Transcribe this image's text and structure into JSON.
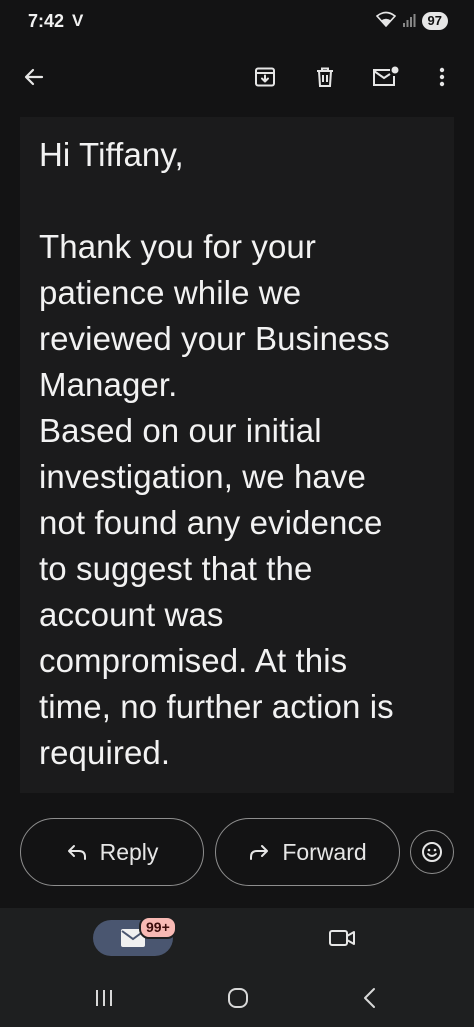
{
  "status_bar": {
    "time": "7:42",
    "carrier_icon": "V",
    "battery": "97"
  },
  "app_bar": {
    "icons": [
      "back-arrow-icon",
      "archive-icon",
      "delete-icon",
      "mark-unread-icon",
      "more-vert-icon"
    ]
  },
  "email": {
    "greeting": "Hi Tiffany,",
    "body_lines": [
      "Thank you for your",
      "patience while we",
      "reviewed your Business",
      "Manager.",
      "Based on our initial",
      "investigation, we have",
      "not found any evidence",
      "to suggest that the",
      "account was",
      "compromised. At this",
      "time, no further action is",
      "required."
    ]
  },
  "actions": {
    "reply_label": "Reply",
    "forward_label": "Forward"
  },
  "bottom_nav": {
    "mail_badge": "99+"
  }
}
